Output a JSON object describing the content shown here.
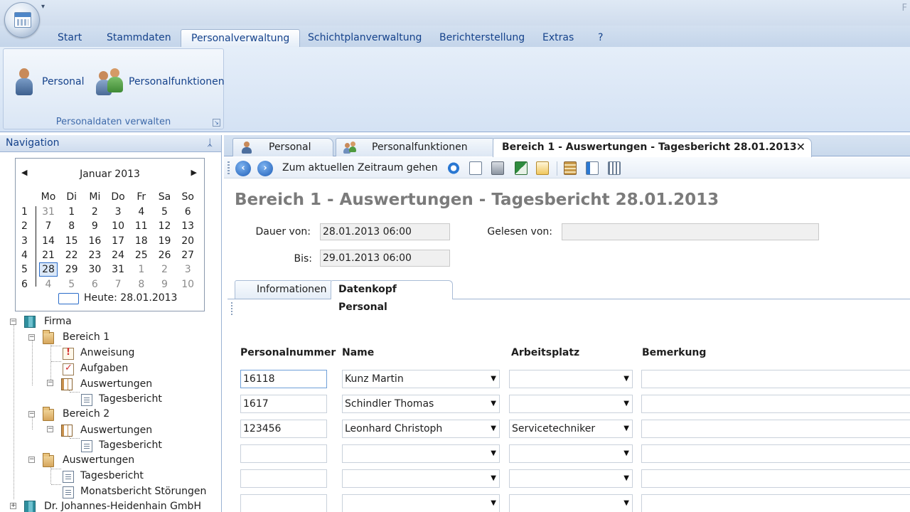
{
  "app": {
    "title_right": "F"
  },
  "ribbon": {
    "tabs": [
      "Start",
      "Stammdaten",
      "Personalverwaltung",
      "Schichtplanverwaltung",
      "Berichterstellung",
      "Extras",
      "?"
    ],
    "active_tab": "Personalverwaltung",
    "group": {
      "label": "Personaldaten verwalten",
      "buttons": [
        "Personal",
        "Personalfunktionen"
      ]
    }
  },
  "nav": {
    "title": "Navigation",
    "calendar": {
      "month_label": "Januar 2013",
      "weekdays": [
        "Mo",
        "Di",
        "Mi",
        "Do",
        "Fr",
        "Sa",
        "So"
      ],
      "weeks": [
        "1",
        "2",
        "3",
        "4",
        "5",
        "6"
      ],
      "rows": [
        [
          "31",
          "1",
          "2",
          "3",
          "4",
          "5",
          "6"
        ],
        [
          "7",
          "8",
          "9",
          "10",
          "11",
          "12",
          "13"
        ],
        [
          "14",
          "15",
          "16",
          "17",
          "18",
          "19",
          "20"
        ],
        [
          "21",
          "22",
          "23",
          "24",
          "25",
          "26",
          "27"
        ],
        [
          "28",
          "29",
          "30",
          "31",
          "1",
          "2",
          "3"
        ],
        [
          "4",
          "5",
          "6",
          "7",
          "8",
          "9",
          "10"
        ]
      ],
      "today_label": "Heute: 28.01.2013"
    },
    "tree": {
      "firma": "Firma",
      "bereich1": "Bereich 1",
      "anweisung": "Anweisung",
      "aufgaben": "Aufgaben",
      "auswertungen": "Auswertungen",
      "tagesbericht": "Tagesbericht",
      "bereich2": "Bereich 2",
      "monatsbericht": "Monatsbericht Störungen",
      "company2": "Dr. Johannes-Heidenhain GmbH"
    }
  },
  "doc": {
    "tabs": [
      "Personal",
      "Personalfunktionen",
      "Bereich 1 - Auswertungen - Tagesbericht 28.01.2013"
    ],
    "toolbar_text": "Zum aktuellen Zeitraum gehen",
    "title": "Bereich 1 - Auswertungen - Tagesbericht 28.01.2013",
    "fields": {
      "dauer_label": "Dauer von:",
      "dauer_value": "28.01.2013 06:00",
      "bis_label": "Bis:",
      "bis_value": "29.01.2013 06:00",
      "gelesen_label": "Gelesen von:",
      "gelesen_value": ""
    },
    "inner_tabs": [
      "Informationen",
      "Datenkopf Personal"
    ],
    "grid": {
      "columns": [
        "Personalnummer",
        "Name",
        "Arbeitsplatz",
        "Bemerkung"
      ],
      "rows": [
        [
          "16118",
          "Kunz Martin",
          "",
          ""
        ],
        [
          "1617",
          "Schindler Thomas",
          "",
          ""
        ],
        [
          "123456",
          "Leonhard Christoph",
          "Servicetechniker",
          ""
        ],
        [
          "",
          "",
          "",
          ""
        ],
        [
          "",
          "",
          "",
          ""
        ],
        [
          "",
          "",
          "",
          ""
        ]
      ]
    }
  }
}
